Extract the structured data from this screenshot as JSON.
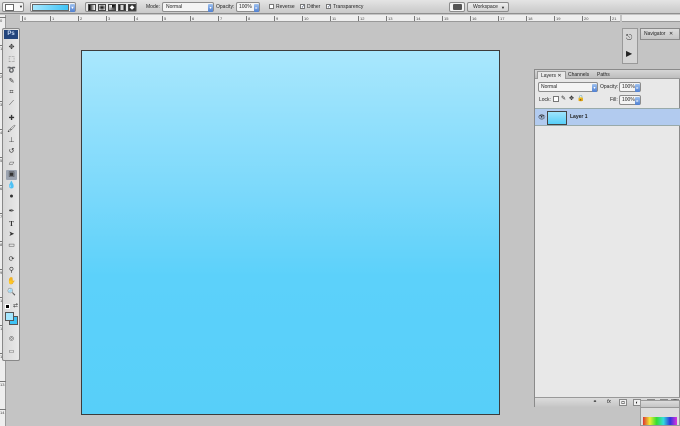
{
  "options_bar": {
    "mode_label": "Mode:",
    "mode_value": "Normal",
    "opacity_label": "Opacity:",
    "opacity_value": "100%",
    "reverse_label": "Reverse",
    "dither_label": "Dither",
    "transparency_label": "Transparency",
    "workspace_label": "Workspace",
    "gradient_colors": [
      "#a6e8ff",
      "#3fc3f5"
    ]
  },
  "rulers": {
    "h_ticks": [
      "0",
      "1",
      "2",
      "3",
      "4",
      "5",
      "6",
      "7",
      "8",
      "9",
      "10",
      "11",
      "12",
      "13",
      "14",
      "15",
      "16",
      "17",
      "18",
      "19",
      "20",
      "21"
    ],
    "v_ticks": [
      "0",
      "1",
      "2",
      "3",
      "4",
      "5",
      "6",
      "7",
      "8",
      "9",
      "10",
      "11",
      "12",
      "13",
      "14"
    ]
  },
  "toolbox": {
    "logo": "Ps",
    "foreground_color": "#a6e8ff",
    "background_color": "#3fc3f5"
  },
  "canvas": {
    "gradient_top": "#a9e7fd",
    "gradient_bottom": "#57cff9"
  },
  "navigator": {
    "tab_label": "Navigator"
  },
  "layers_panel": {
    "tabs": [
      "Layers",
      "Channels",
      "Paths"
    ],
    "blend_mode": "Normal",
    "opacity_label": "Opacity:",
    "opacity_value": "100%",
    "lock_label": "Lock:",
    "fill_label": "Fill:",
    "fill_value": "100%",
    "layers": [
      {
        "name": "Layer 1",
        "selected": true
      }
    ]
  }
}
